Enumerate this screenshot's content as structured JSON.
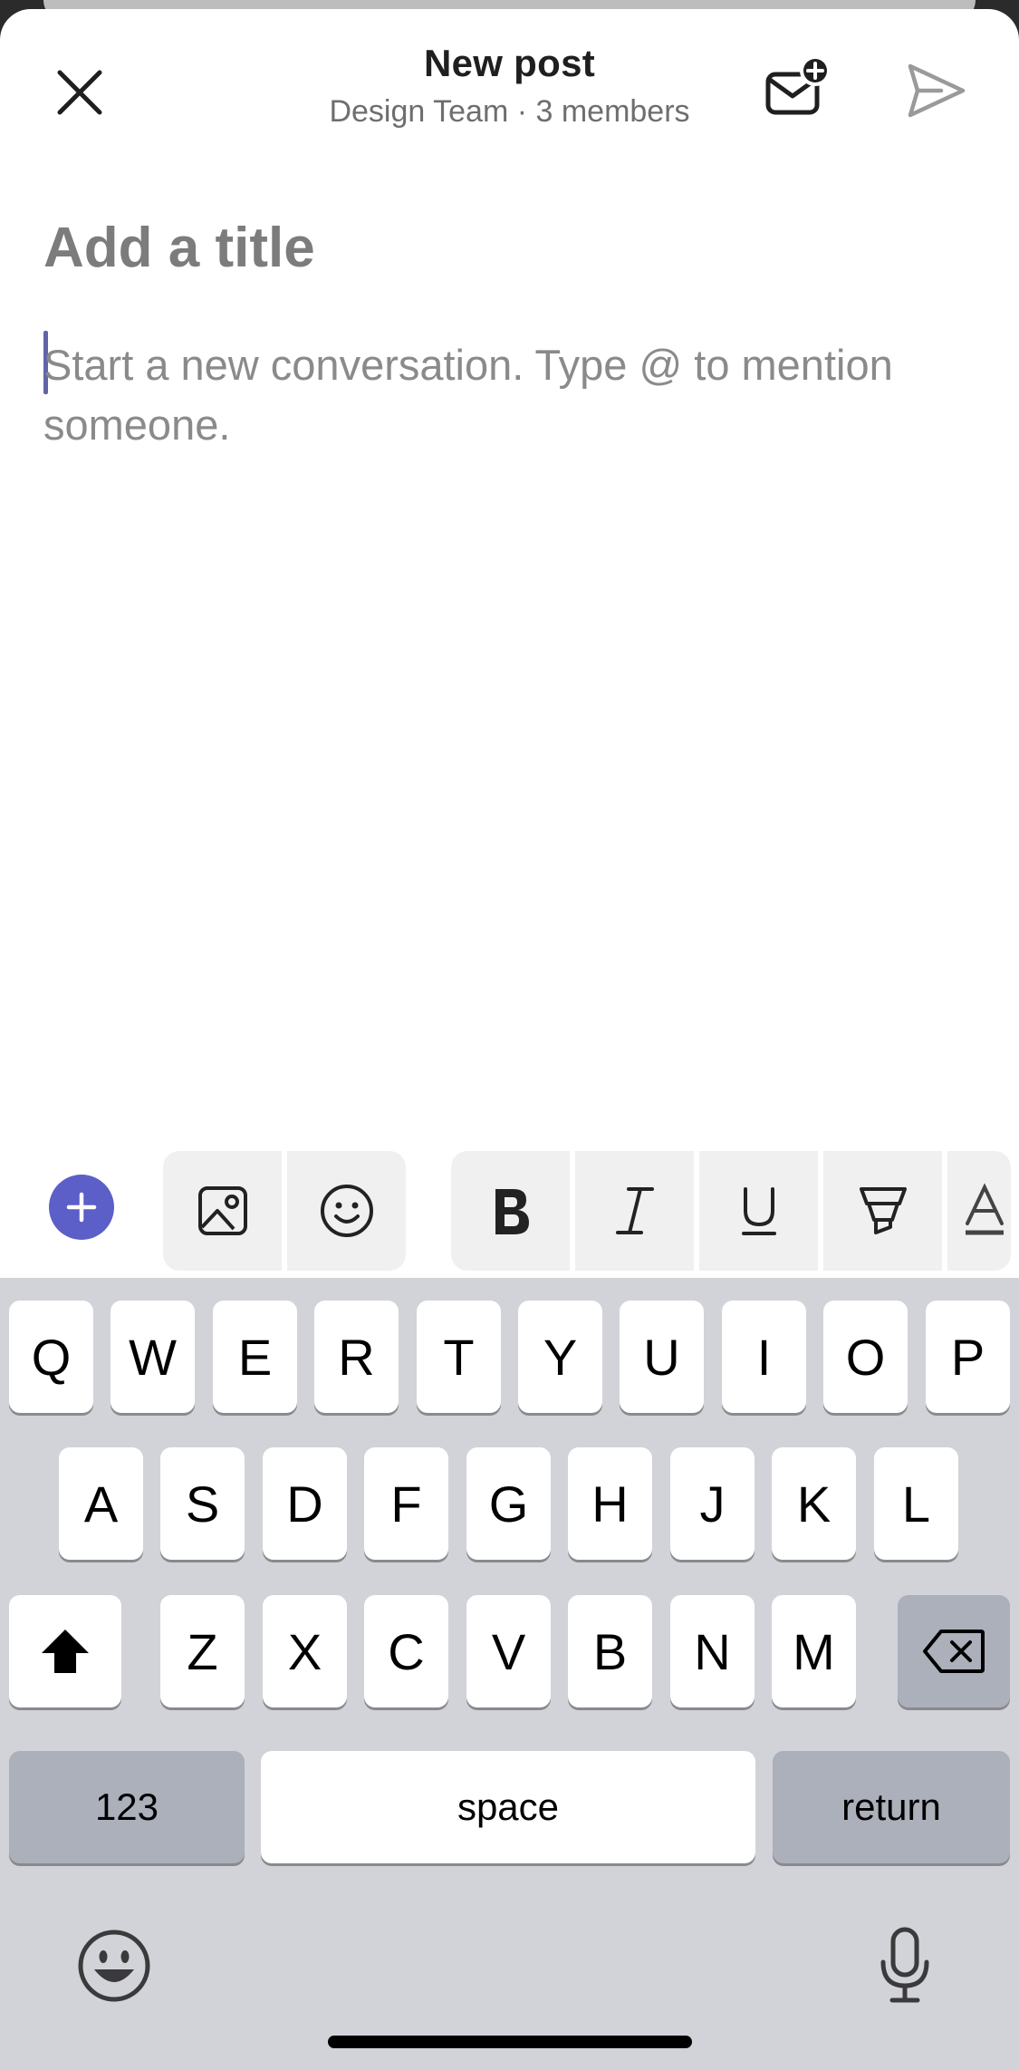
{
  "header": {
    "title": "New post",
    "subtitle": "Design Team · 3 members"
  },
  "compose": {
    "title_placeholder": "Add a title",
    "body_placeholder": "Start a new conversation. Type @ to mention someone."
  },
  "toolbar": {
    "accent_color": "#5b5fc7",
    "icons": [
      "plus-icon",
      "image-icon",
      "emoji-icon",
      "bold-icon",
      "italic-icon",
      "underline-icon",
      "highlighter-icon",
      "font-color-icon"
    ]
  },
  "keyboard": {
    "row1": [
      "Q",
      "W",
      "E",
      "R",
      "T",
      "Y",
      "U",
      "I",
      "O",
      "P"
    ],
    "row2": [
      "A",
      "S",
      "D",
      "F",
      "G",
      "H",
      "J",
      "K",
      "L"
    ],
    "row3": [
      "Z",
      "X",
      "C",
      "V",
      "B",
      "N",
      "M"
    ],
    "numbers_label": "123",
    "space_label": "space",
    "return_label": "return"
  }
}
